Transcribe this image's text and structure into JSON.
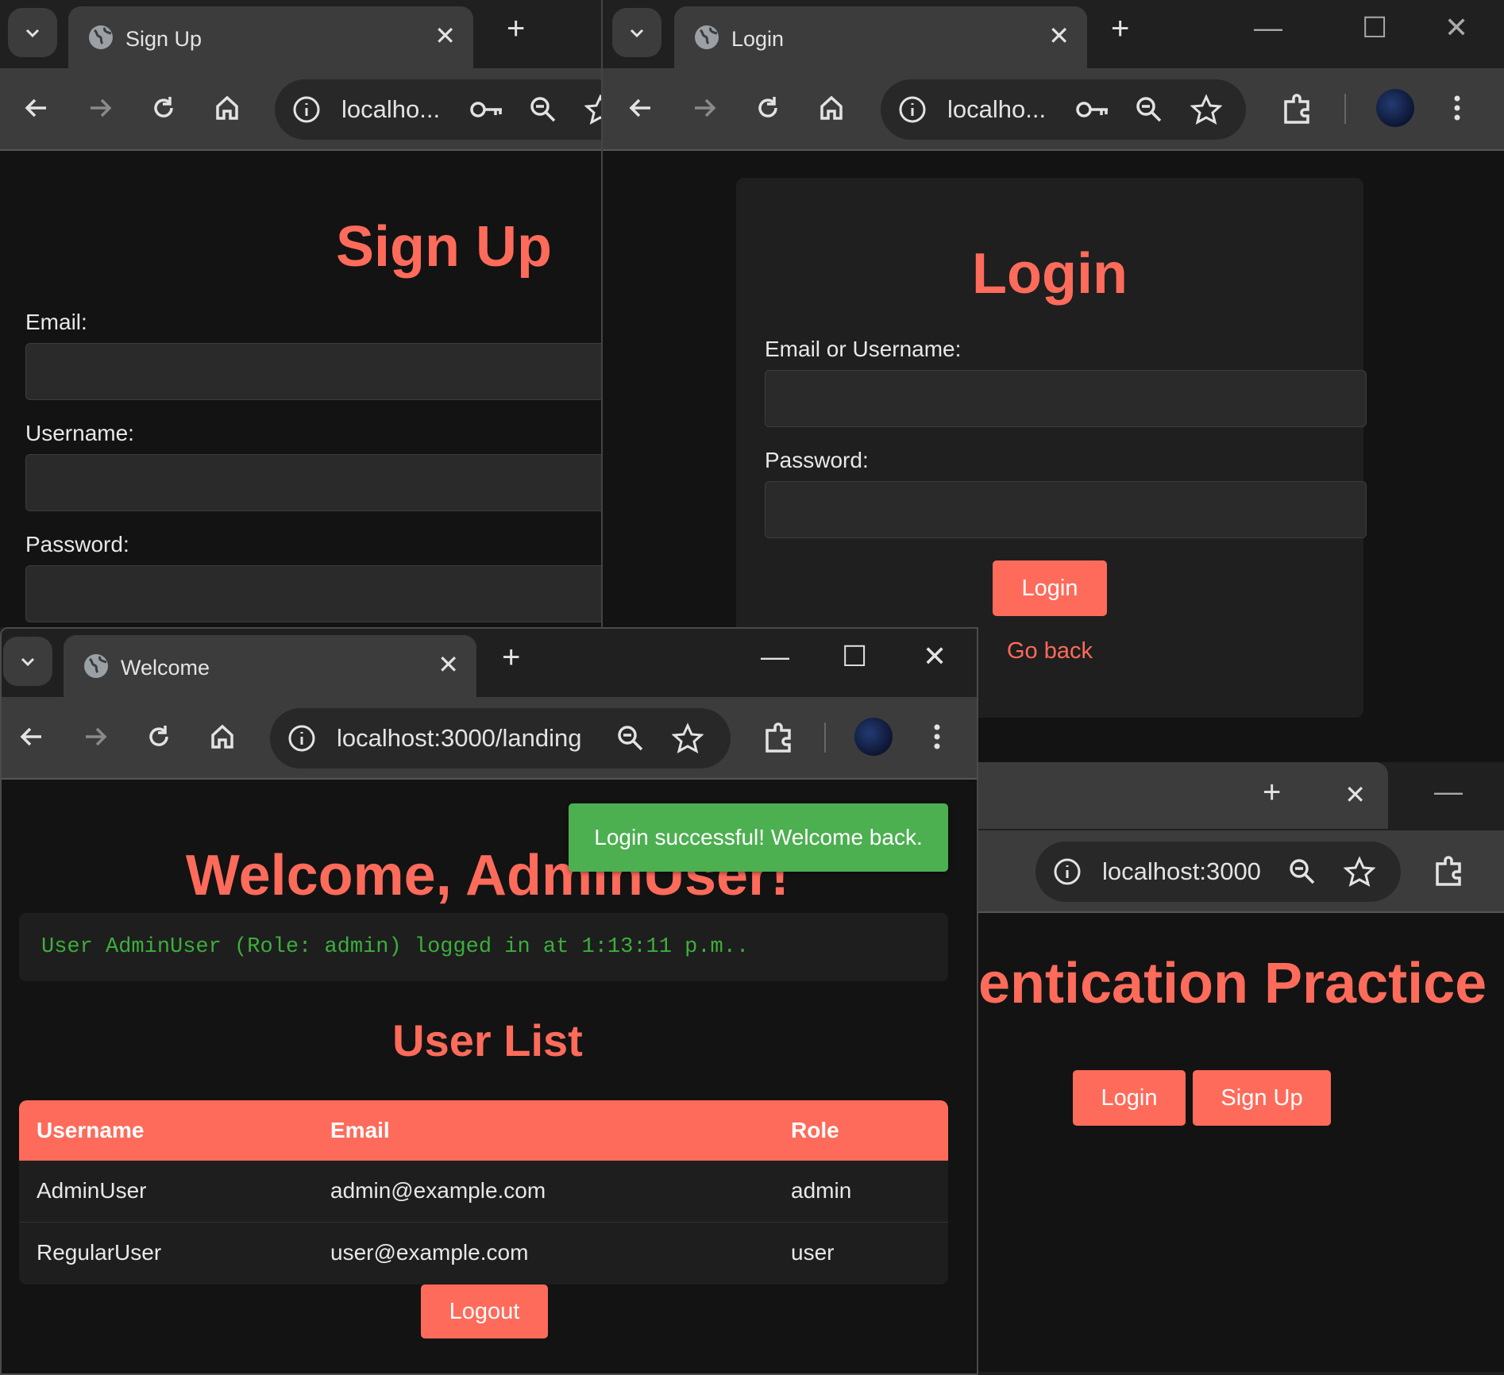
{
  "signup_window": {
    "tab_title": "Sign Up",
    "url": "localho...",
    "heading": "Sign Up",
    "labels": [
      "Email:",
      "Username:",
      "Password:"
    ]
  },
  "login_window": {
    "tab_title": "Login",
    "url": "localho...",
    "heading": "Login",
    "email_label": "Email or Username:",
    "password_label": "Password:",
    "login_button": "Login",
    "go_back_link": "Go back"
  },
  "home_window": {
    "url": "localhost:3000",
    "heading": "hentication Practice",
    "login_button": "Login",
    "signup_button": "Sign Up"
  },
  "welcome_window": {
    "tab_title": "Welcome",
    "url": "localhost:3000/landing",
    "toast": "Login successful! Welcome back.",
    "heading": "Welcome, AdminUser!",
    "log_line": "User AdminUser (Role: admin) logged in at 1:13:11 p.m..",
    "user_list_heading": "User List",
    "table": {
      "headers": [
        "Username",
        "Email",
        "Role"
      ],
      "rows": [
        [
          "AdminUser",
          "admin@example.com",
          "admin"
        ],
        [
          "RegularUser",
          "user@example.com",
          "user"
        ]
      ]
    },
    "logout_button": "Logout"
  },
  "colors": {
    "accent": "#ff6b5b",
    "toast": "#4caf50",
    "log_text": "#3cae3c",
    "page_bg": "#131313"
  },
  "icons": [
    "chevron-down-icon",
    "globe-icon",
    "close-icon",
    "plus-icon",
    "back-arrow-icon",
    "forward-arrow-icon",
    "reload-icon",
    "home-icon",
    "info-icon",
    "key-icon",
    "zoom-icon",
    "star-icon",
    "extensions-icon",
    "more-icon",
    "minimize-icon",
    "maximize-icon"
  ]
}
